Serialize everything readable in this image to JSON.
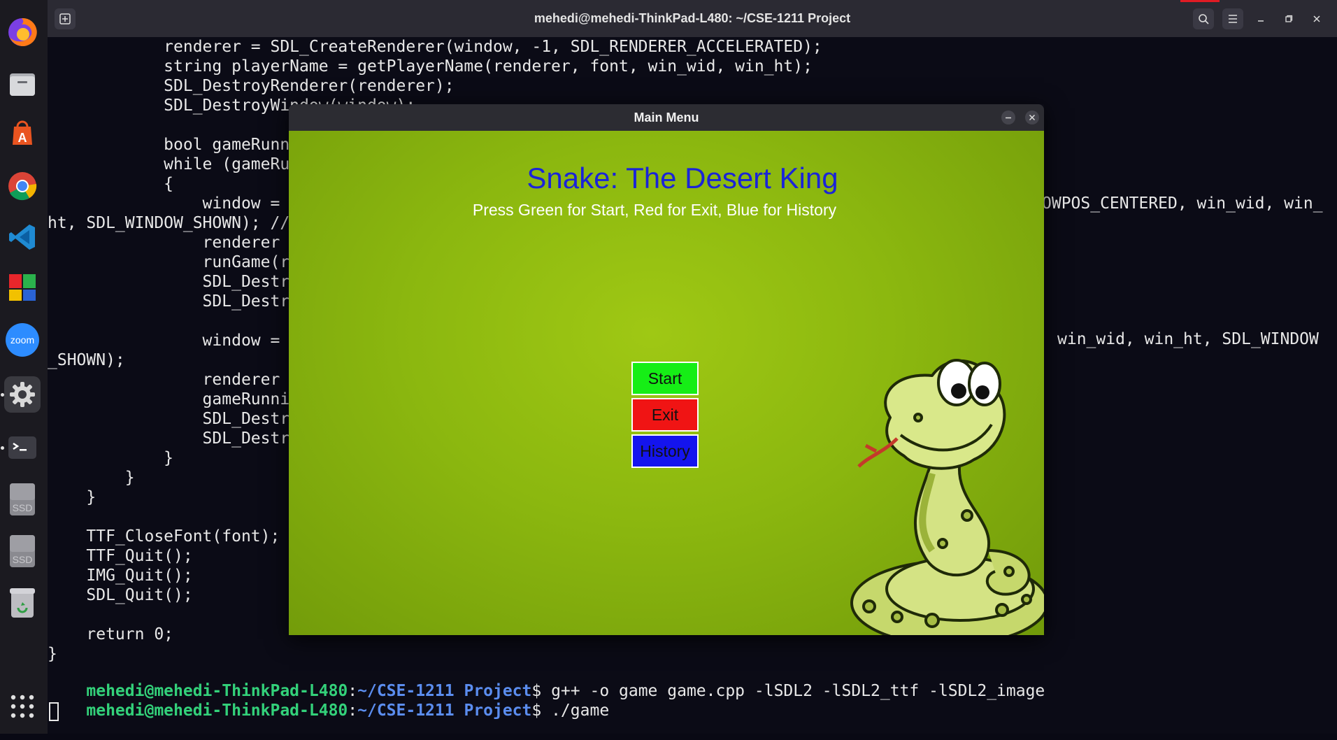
{
  "terminal": {
    "title": "mehedi@mehedi-ThinkPad-L480: ~/CSE-1211 Project",
    "code_lines": [
      "            renderer = SDL_CreateRenderer(window, -1, SDL_RENDERER_ACCELERATED);",
      "            string playerName = getPlayerName(renderer, font, win_wid, win_ht);",
      "            SDL_DestroyRenderer(renderer);",
      "            SDL_DestroyWindow(window);",
      "",
      "            bool gameRunn",
      "            while (gameRu",
      "            {",
      "                window =",
      "ht, SDL_WINDOW_SHOWN); //",
      "                renderer",
      "                runGame(r",
      "                SDL_Destr",
      "                SDL_Destr",
      "",
      "                window =",
      "_SHOWN);",
      "                renderer",
      "                gameRunni",
      "                SDL_Destr",
      "                SDL_Destr",
      "            }",
      "        }",
      "    }",
      "",
      "    TTF_CloseFont(font);",
      "    TTF_Quit();",
      "    IMG_Quit();",
      "    SDL_Quit();",
      "",
      "    return 0;",
      "}"
    ],
    "right_fragment_1": "OWPOS_CENTERED, win_wid, win_",
    "right_fragment_2": "win_wid, win_ht, SDL_WINDOW",
    "prompt_user": "mehedi@mehedi-ThinkPad-L480",
    "prompt_sep": ":",
    "prompt_path": "~/CSE-1211 Project",
    "prompt_dollar": "$ ",
    "command_1": "g++ -o game game.cpp -lSDL2 -lSDL2_ttf -lSDL2_image",
    "command_2": "./game"
  },
  "game_window": {
    "title": "Main Menu",
    "heading": "Snake: The Desert King",
    "instructions": "Press Green for Start, Red for Exit, Blue for History",
    "buttons": {
      "start": "Start",
      "exit": "Exit",
      "history": "History"
    },
    "colors": {
      "start": "#16ee16",
      "exit": "#f01414",
      "history": "#1414ee",
      "heading": "#1a24d8"
    }
  },
  "dock": {
    "items": [
      "firefox-icon",
      "files-icon",
      "app-center-icon",
      "chrome-icon",
      "vscode-icon",
      "office-icon",
      "zoom-icon",
      "settings-icon",
      "terminal-icon",
      "ssd-drive-icon",
      "ssd-drive-icon",
      "trash-icon",
      "show-apps-icon"
    ],
    "zoom_label": "zoom",
    "ssd_label": "SSD"
  }
}
